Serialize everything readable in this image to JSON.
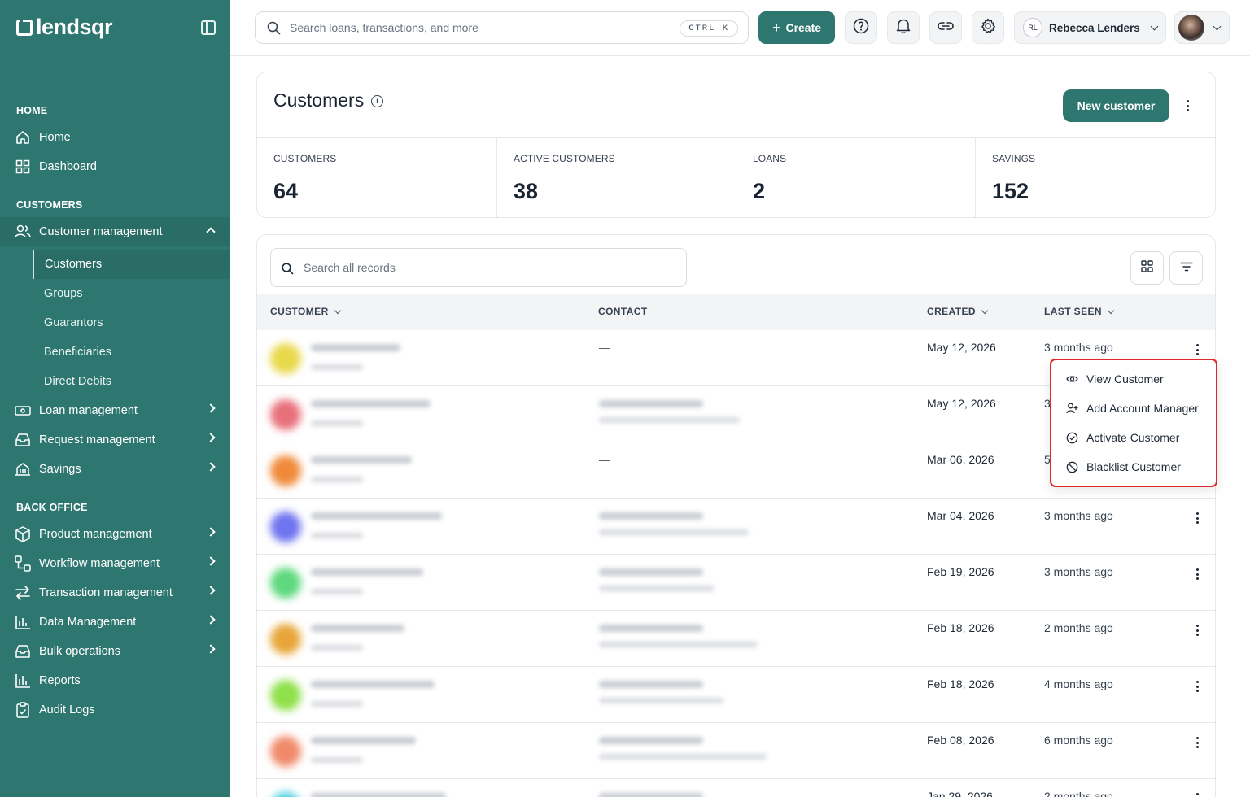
{
  "brand": {
    "name": "lendsqr"
  },
  "sidebar": {
    "sections": {
      "home": "HOME",
      "customers": "CUSTOMERS",
      "back_office": "BACK OFFICE"
    },
    "items": {
      "home": "Home",
      "dashboard": "Dashboard",
      "customer_management": "Customer management",
      "loan_management": "Loan management",
      "request_management": "Request management",
      "savings": "Savings",
      "product_management": "Product management",
      "workflow_management": "Workflow management",
      "transaction_management": "Transaction management",
      "data_management": "Data Management",
      "bulk_operations": "Bulk operations",
      "reports": "Reports",
      "audit_logs": "Audit Logs"
    },
    "sub_items": [
      "Customers",
      "Groups",
      "Guarantors",
      "Beneficiaries",
      "Direct Debits"
    ]
  },
  "topbar": {
    "search_placeholder": "Search loans, transactions, and more",
    "shortcut": "CTRL K",
    "create_label": "Create",
    "user_initials": "RL",
    "user_name": "Rebecca Lenders"
  },
  "page": {
    "title": "Customers",
    "new_customer_label": "New customer",
    "stats": [
      {
        "label": "CUSTOMERS",
        "value": "64"
      },
      {
        "label": "ACTIVE CUSTOMERS",
        "value": "38"
      },
      {
        "label": "LOANS",
        "value": "2"
      },
      {
        "label": "SAVINGS",
        "value": "152"
      }
    ]
  },
  "table": {
    "search_placeholder": "Search all records",
    "columns": [
      "CUSTOMER",
      "CONTACT",
      "CREATED",
      "LAST SEEN"
    ],
    "rows": [
      {
        "contact": "—",
        "created": "May 12, 2026",
        "last_seen": "3 months ago"
      },
      {
        "contact": "",
        "created": "May 12, 2026",
        "last_seen": "3"
      },
      {
        "contact": "—",
        "created": "Mar 06, 2026",
        "last_seen": "5"
      },
      {
        "contact": "",
        "created": "Mar 04, 2026",
        "last_seen": "3 months ago"
      },
      {
        "contact": "",
        "created": "Feb 19, 2026",
        "last_seen": "3 months ago"
      },
      {
        "contact": "",
        "created": "Feb 18, 2026",
        "last_seen": "2 months ago"
      },
      {
        "contact": "",
        "created": "Feb 18, 2026",
        "last_seen": "4 months ago"
      },
      {
        "contact": "",
        "created": "Feb 08, 2026",
        "last_seen": "6 months ago"
      },
      {
        "contact": "",
        "created": "Jan 29, 2026",
        "last_seen": "2 months ago"
      }
    ],
    "avatar_colors": [
      "#e8d94a",
      "#e8707a",
      "#f08a3a",
      "#6f74f0",
      "#5fd87e",
      "#e8a63a",
      "#8fe04a",
      "#f08a6a",
      "#4ad0e0"
    ]
  },
  "row_menu": {
    "items": [
      "View Customer",
      "Add Account Manager",
      "Activate Customer",
      "Blacklist Customer"
    ]
  },
  "colors": {
    "brand": "#2e7770",
    "highlight": "#e0282e"
  }
}
